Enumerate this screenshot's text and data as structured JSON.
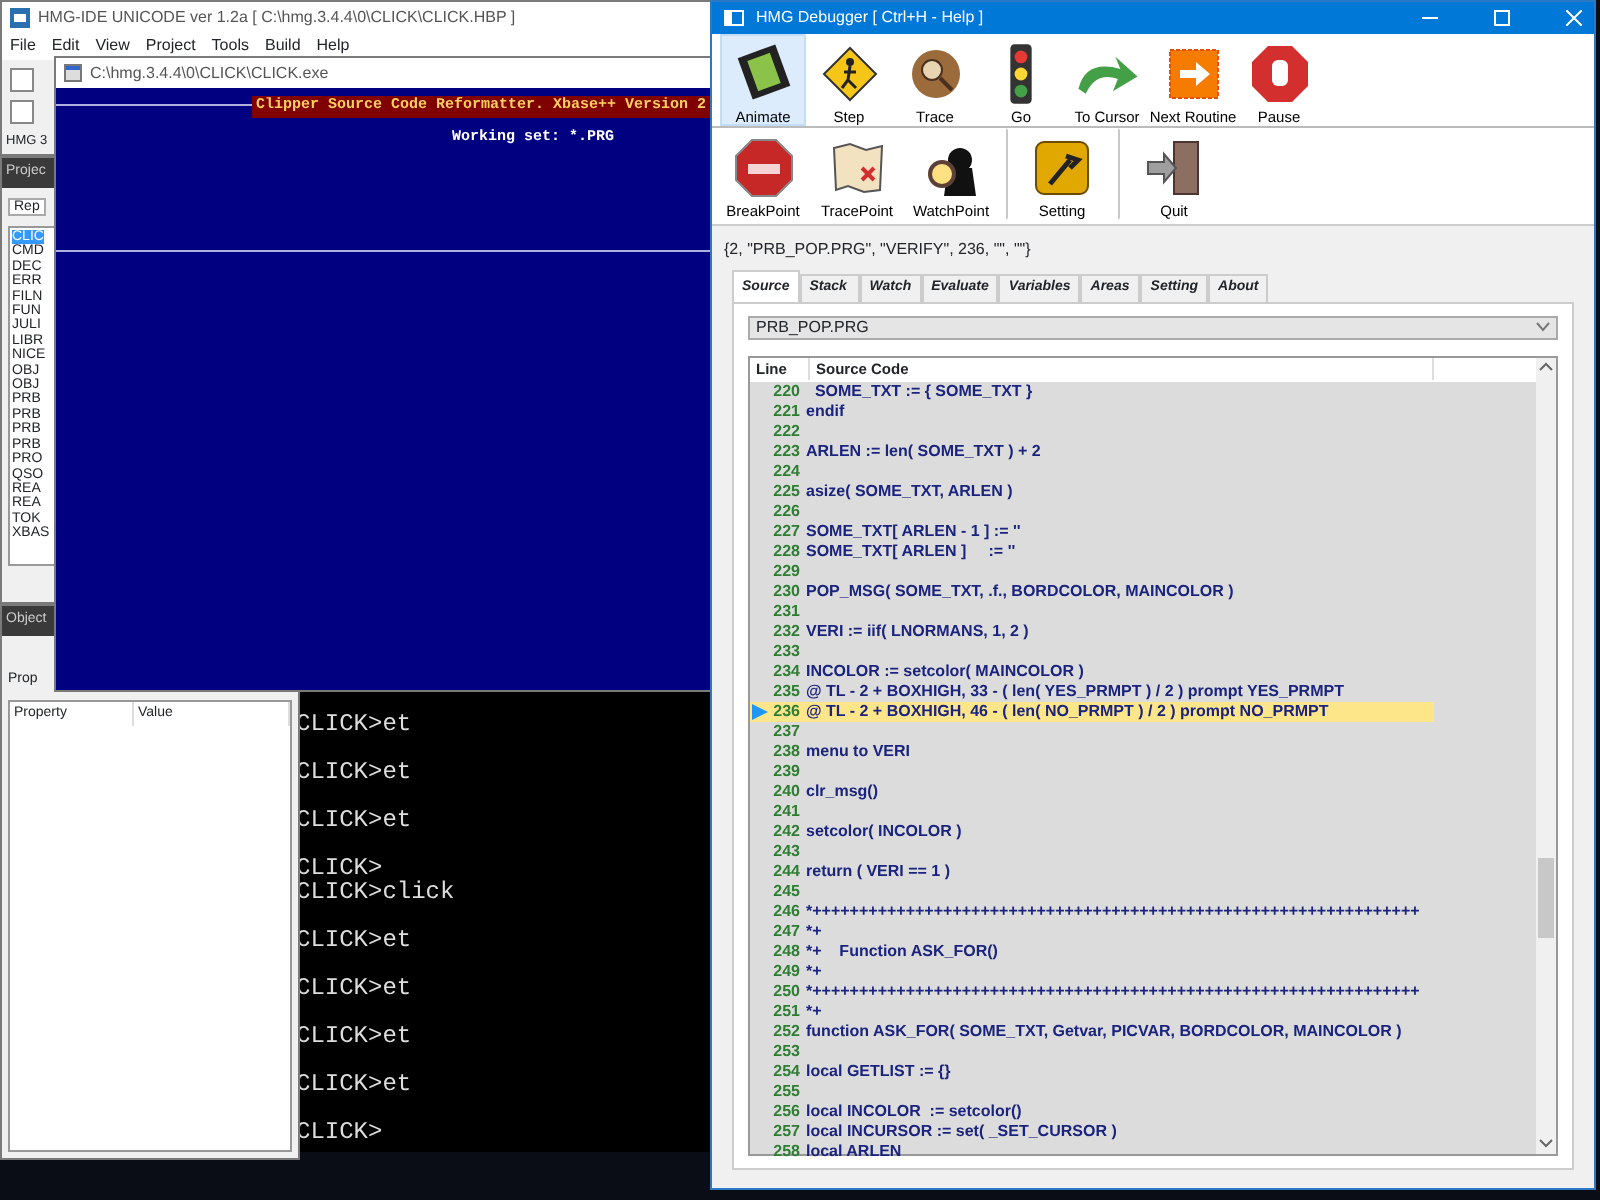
{
  "ide_window": {
    "title": "HMG-IDE  UNICODE  ver 1.2a  [ C:\\hmg.3.4.4\\0\\CLICK\\CLICK.HBP ]",
    "menu": [
      "File",
      "Edit",
      "View",
      "Project",
      "Tools",
      "Build",
      "Help"
    ],
    "status_label": "HMG 3"
  },
  "project_panel": {
    "title": "Projec",
    "tab": "Rep",
    "files": [
      {
        "label": "CLIC",
        "selected": true
      },
      {
        "label": "CMD",
        "selected": false
      },
      {
        "label": "DEC",
        "selected": false
      },
      {
        "label": "ERR",
        "selected": false
      },
      {
        "label": "FILN",
        "selected": false
      },
      {
        "label": "FUN",
        "selected": false
      },
      {
        "label": "JULI",
        "selected": false
      },
      {
        "label": "LIBR",
        "selected": false
      },
      {
        "label": "NICE",
        "selected": false
      },
      {
        "label": "OBJ",
        "selected": false
      },
      {
        "label": "OBJ",
        "selected": false
      },
      {
        "label": "PRB",
        "selected": false
      },
      {
        "label": "PRB",
        "selected": false
      },
      {
        "label": "PRB",
        "selected": false
      },
      {
        "label": "PRB",
        "selected": false
      },
      {
        "label": "PRO",
        "selected": false
      },
      {
        "label": "QSO",
        "selected": false
      },
      {
        "label": "REA",
        "selected": false
      },
      {
        "label": "REA",
        "selected": false
      },
      {
        "label": "TOK",
        "selected": false
      },
      {
        "label": "XBAS",
        "selected": false
      }
    ]
  },
  "object_panel": {
    "title": "Object",
    "tab": "Prop",
    "columns": [
      "Property",
      "Value"
    ]
  },
  "console_window": {
    "title": "C:\\hmg.3.4.4\\0\\CLICK\\CLICK.exe",
    "banner": "Clipper Source Code Reformatter.  Xbase++ Version 2",
    "working_set": "Working set: *.PRG"
  },
  "cmd_window": {
    "lines": [
      {
        "text": "CLICK>et",
        "blank_after": true
      },
      {
        "text": "CLICK>et",
        "blank_after": true
      },
      {
        "text": "CLICK>et",
        "blank_after": true
      },
      {
        "text": "CLICK>",
        "blank_after": false
      },
      {
        "text": "CLICK>click",
        "blank_after": true
      },
      {
        "text": "CLICK>et",
        "blank_after": true
      },
      {
        "text": "CLICK>et",
        "blank_after": true
      },
      {
        "text": "CLICK>et",
        "blank_after": true
      },
      {
        "text": "CLICK>et",
        "blank_after": true
      },
      {
        "text": "CLICK>",
        "blank_after": false
      }
    ]
  },
  "debugger_window": {
    "title": "HMG Debugger   [ Ctrl+H - Help ]",
    "toolbar": [
      {
        "label": "Animate",
        "selected": true
      },
      {
        "label": "Step",
        "selected": false
      },
      {
        "label": "Trace",
        "selected": false
      },
      {
        "label": "Go",
        "selected": false
      },
      {
        "label": "To Cursor",
        "selected": false
      },
      {
        "label": "Next Routine",
        "selected": false
      },
      {
        "label": "Pause",
        "selected": false
      }
    ],
    "toolbar_2": [
      {
        "label": "BreakPoint",
        "separator_before": false
      },
      {
        "label": "TracePoint",
        "separator_before": false
      },
      {
        "label": "WatchPoint",
        "separator_before": false
      },
      {
        "label": "Setting",
        "separator_before": true
      },
      {
        "label": "Quit",
        "separator_before": true
      }
    ],
    "call_info": "{2, \"PRB_POP.PRG\", \"VERIFY\", 236, \"\", \"\"}",
    "tabs": [
      {
        "label": "Source",
        "selected": true
      },
      {
        "label": "Stack",
        "selected": false
      },
      {
        "label": "Watch",
        "selected": false
      },
      {
        "label": "Evaluate",
        "selected": false
      },
      {
        "label": "Variables",
        "selected": false
      },
      {
        "label": "Areas",
        "selected": false
      },
      {
        "label": "Setting",
        "selected": false
      },
      {
        "label": "About",
        "selected": false
      }
    ],
    "module_select": "PRB_POP.PRG",
    "columns": [
      "Line",
      "Source Code"
    ],
    "rows": [
      {
        "line": "220",
        "code": "  SOME_TXT := { SOME_TXT }",
        "current": false
      },
      {
        "line": "221",
        "code": "endif",
        "current": false
      },
      {
        "line": "222",
        "current": false
      },
      {
        "line": "223",
        "code": "ARLEN := len( SOME_TXT ) + 2",
        "current": false
      },
      {
        "line": "224",
        "current": false
      },
      {
        "line": "225",
        "code": "asize( SOME_TXT, ARLEN )",
        "current": false
      },
      {
        "line": "226",
        "current": false
      },
      {
        "line": "227",
        "code": "SOME_TXT[ ARLEN - 1 ] := ''",
        "current": false
      },
      {
        "line": "228",
        "code": "SOME_TXT[ ARLEN ]     := ''",
        "current": false
      },
      {
        "line": "229",
        "current": false
      },
      {
        "line": "230",
        "code": "POP_MSG( SOME_TXT, .f., BORDCOLOR, MAINCOLOR )",
        "current": false
      },
      {
        "line": "231",
        "current": false
      },
      {
        "line": "232",
        "code": "VERI := iif( LNORMANS, 1, 2 )",
        "current": false
      },
      {
        "line": "233",
        "current": false
      },
      {
        "line": "234",
        "code": "INCOLOR := setcolor( MAINCOLOR )",
        "current": false
      },
      {
        "line": "235",
        "code": "@ TL - 2 + BOXHIGH, 33 - ( len( YES_PRMPT ) / 2 ) prompt YES_PRMPT",
        "current": false
      },
      {
        "line": "236",
        "code": "@ TL - 2 + BOXHIGH, 46 - ( len( NO_PRMPT ) / 2 ) prompt NO_PRMPT",
        "current": true
      },
      {
        "line": "237",
        "current": false
      },
      {
        "line": "238",
        "code": "menu to VERI",
        "current": false
      },
      {
        "line": "239",
        "current": false
      },
      {
        "line": "240",
        "code": "clr_msg()",
        "current": false
      },
      {
        "line": "241",
        "current": false
      },
      {
        "line": "242",
        "code": "setcolor( INCOLOR )",
        "current": false
      },
      {
        "line": "243",
        "current": false
      },
      {
        "line": "244",
        "code": "return ( VERI == 1 )",
        "current": false
      },
      {
        "line": "245",
        "current": false
      },
      {
        "line": "246",
        "code": "*+++++++++++++++++++++++++++++++++++++++++++++++++++++++++++++++++",
        "current": false
      },
      {
        "line": "247",
        "code": "*+",
        "current": false
      },
      {
        "line": "248",
        "code": "*+    Function ASK_FOR()",
        "current": false
      },
      {
        "line": "249",
        "code": "*+",
        "current": false
      },
      {
        "line": "250",
        "code": "*+++++++++++++++++++++++++++++++++++++++++++++++++++++++++++++++++",
        "current": false
      },
      {
        "line": "251",
        "code": "*+",
        "current": false
      },
      {
        "line": "252",
        "code": "function ASK_FOR( SOME_TXT, Getvar, PICVAR, BORDCOLOR, MAINCOLOR )",
        "current": false
      },
      {
        "line": "253",
        "current": false
      },
      {
        "line": "254",
        "code": "local GETLIST := {}",
        "current": false
      },
      {
        "line": "255",
        "current": false
      },
      {
        "line": "256",
        "code": "local INCOLOR  := setcolor()",
        "current": false
      },
      {
        "line": "257",
        "code": "local INCURSOR := set( _SET_CURSOR )",
        "current": false
      },
      {
        "line": "258",
        "code": "local ARLEN",
        "current": false
      }
    ]
  }
}
